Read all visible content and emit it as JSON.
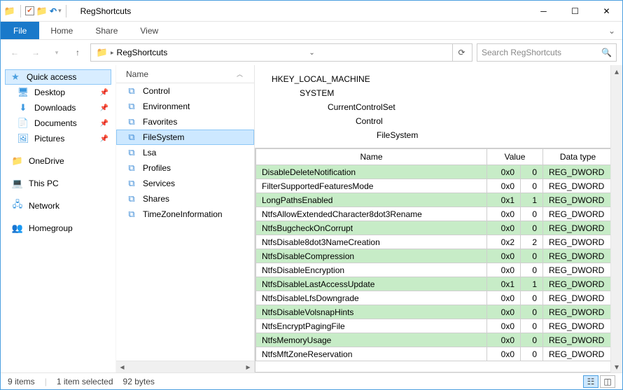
{
  "window": {
    "title": "RegShortcuts"
  },
  "ribbon": {
    "file": "File",
    "tabs": [
      "Home",
      "Share",
      "View"
    ]
  },
  "address": {
    "crumb": "RegShortcuts"
  },
  "search": {
    "placeholder": "Search RegShortcuts"
  },
  "nav": {
    "quick_access": "Quick access",
    "pinned": [
      {
        "label": "Desktop"
      },
      {
        "label": "Downloads"
      },
      {
        "label": "Documents"
      },
      {
        "label": "Pictures"
      }
    ],
    "onedrive": "OneDrive",
    "thispc": "This PC",
    "network": "Network",
    "homegroup": "Homegroup"
  },
  "filelist": {
    "header": "Name",
    "items": [
      {
        "name": "Control"
      },
      {
        "name": "Environment"
      },
      {
        "name": "Favorites"
      },
      {
        "name": "FileSystem",
        "selected": true
      },
      {
        "name": "Lsa"
      },
      {
        "name": "Profiles"
      },
      {
        "name": "Services"
      },
      {
        "name": "Shares"
      },
      {
        "name": "TimeZoneInformation"
      }
    ]
  },
  "regpath": [
    "HKEY_LOCAL_MACHINE",
    "SYSTEM",
    "CurrentControlSet",
    "Control",
    "FileSystem"
  ],
  "regheaders": {
    "name": "Name",
    "value": "Value",
    "dtype": "Data type"
  },
  "regrows": [
    {
      "name": "DisableDeleteNotification",
      "hex": "0x0",
      "val": "0",
      "type": "REG_DWORD",
      "hl": true
    },
    {
      "name": "FilterSupportedFeaturesMode",
      "hex": "0x0",
      "val": "0",
      "type": "REG_DWORD",
      "hl": false
    },
    {
      "name": "LongPathsEnabled",
      "hex": "0x1",
      "val": "1",
      "type": "REG_DWORD",
      "hl": true
    },
    {
      "name": "NtfsAllowExtendedCharacter8dot3Rename",
      "hex": "0x0",
      "val": "0",
      "type": "REG_DWORD",
      "hl": false
    },
    {
      "name": "NtfsBugcheckOnCorrupt",
      "hex": "0x0",
      "val": "0",
      "type": "REG_DWORD",
      "hl": true
    },
    {
      "name": "NtfsDisable8dot3NameCreation",
      "hex": "0x2",
      "val": "2",
      "type": "REG_DWORD",
      "hl": false
    },
    {
      "name": "NtfsDisableCompression",
      "hex": "0x0",
      "val": "0",
      "type": "REG_DWORD",
      "hl": true
    },
    {
      "name": "NtfsDisableEncryption",
      "hex": "0x0",
      "val": "0",
      "type": "REG_DWORD",
      "hl": false
    },
    {
      "name": "NtfsDisableLastAccessUpdate",
      "hex": "0x1",
      "val": "1",
      "type": "REG_DWORD",
      "hl": true
    },
    {
      "name": "NtfsDisableLfsDowngrade",
      "hex": "0x0",
      "val": "0",
      "type": "REG_DWORD",
      "hl": false
    },
    {
      "name": "NtfsDisableVolsnapHints",
      "hex": "0x0",
      "val": "0",
      "type": "REG_DWORD",
      "hl": true
    },
    {
      "name": "NtfsEncryptPagingFile",
      "hex": "0x0",
      "val": "0",
      "type": "REG_DWORD",
      "hl": false
    },
    {
      "name": "NtfsMemoryUsage",
      "hex": "0x0",
      "val": "0",
      "type": "REG_DWORD",
      "hl": true
    },
    {
      "name": "NtfsMftZoneReservation",
      "hex": "0x0",
      "val": "0",
      "type": "REG_DWORD",
      "hl": false
    }
  ],
  "status": {
    "items": "9 items",
    "selected": "1 item selected",
    "size": "92 bytes"
  }
}
